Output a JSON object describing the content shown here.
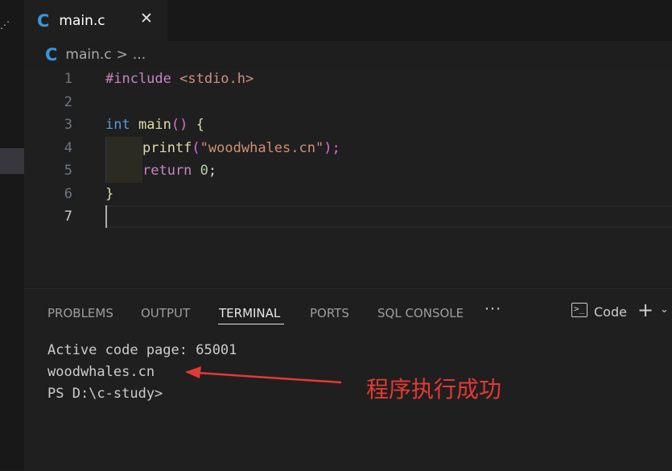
{
  "tab": {
    "icon": "c-language-icon",
    "icon_glyph": "C",
    "label": "main.c",
    "close": "✕"
  },
  "breadcrumb": {
    "icon_glyph": "C",
    "file": "main.c",
    "sep": ">",
    "rest": "..."
  },
  "editor": {
    "line_numbers": [
      "1",
      "2",
      "3",
      "4",
      "5",
      "6",
      "7"
    ],
    "lines": {
      "l1": {
        "directive": "#include",
        "header": " <stdio.h>"
      },
      "l3": {
        "type": "int",
        "fn": " main",
        "paren": "()",
        "brace": " {"
      },
      "l4": {
        "fn": "printf",
        "open": "(",
        "str": "\"woodwhales.cn\"",
        "close": ");"
      },
      "l5": {
        "kw": "return",
        "num": " 0",
        "semi": ";"
      },
      "l6": {
        "brace": "}"
      }
    }
  },
  "panel": {
    "tabs": [
      "PROBLEMS",
      "OUTPUT",
      "TERMINAL",
      "PORTS",
      "SQL CONSOLE"
    ],
    "active_tab": "TERMINAL",
    "more": "···",
    "terminal_icon_glyph": ">_",
    "terminal_name": "Code",
    "add": "+",
    "dropdown": "⌄"
  },
  "terminal": {
    "lines": [
      "Active code page: 65001",
      "woodwhales.cn",
      "PS D:\\c-study>"
    ]
  },
  "annotation": {
    "text": "程序执行成功",
    "color": "#e53935"
  }
}
